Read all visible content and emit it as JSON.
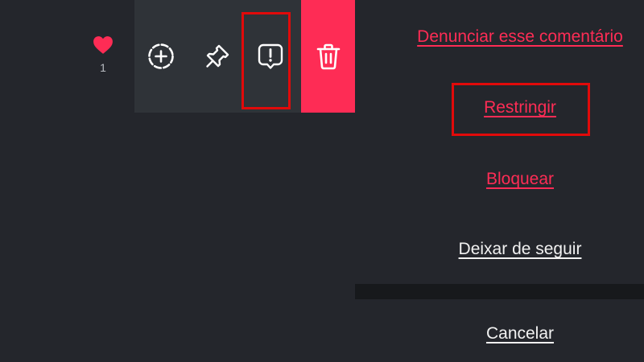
{
  "comment": {
    "like_count": "1"
  },
  "actions": {
    "add_icon": "dashed-circle-plus-icon",
    "pin_icon": "pin-icon",
    "report_icon": "speech-bubble-exclamation-icon",
    "delete_icon": "trash-icon"
  },
  "options": {
    "report": "Denunciar esse comentário",
    "restrict": "Restringir",
    "block": "Bloquear",
    "unfollow": "Deixar de seguir",
    "cancel": "Cancelar"
  },
  "colors": {
    "accent": "#fe2c55",
    "background": "#24262c",
    "highlight": "#e10a0a",
    "heart": "#fe2c55"
  }
}
